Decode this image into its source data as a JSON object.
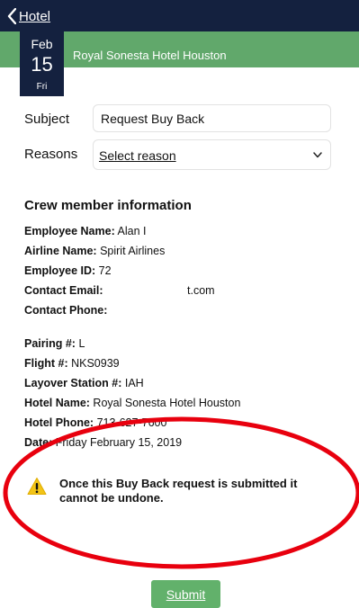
{
  "header": {
    "back_label": "Hotel",
    "hotel_name": "Royal Sonesta Hotel Houston",
    "date": {
      "month": "Feb",
      "day": "15",
      "weekday": "Fri"
    }
  },
  "form": {
    "subject_label": "Subject",
    "subject_value": "Request Buy Back",
    "reasons_label": "Reasons",
    "reasons_value": "Select reason"
  },
  "crew": {
    "title": "Crew member information",
    "rows": [
      {
        "label": "Employee Name:",
        "value": "Alan I"
      },
      {
        "label": "Airline Name:",
        "value": "Spirit Airlines"
      },
      {
        "label": "Employee ID:",
        "value": "72"
      },
      {
        "label": "Contact Email:",
        "value": "t.com"
      },
      {
        "label": "Contact Phone:",
        "value": ""
      }
    ],
    "trip_rows": [
      {
        "label": "Pairing #:",
        "value": "L"
      },
      {
        "label": "Flight #:",
        "value": "NKS0939"
      },
      {
        "label": "Layover Station #:",
        "value": "IAH"
      },
      {
        "label": "Hotel Name:",
        "value": "Royal Sonesta Hotel Houston"
      },
      {
        "label": "Hotel Phone:",
        "value": "713-627-7600"
      },
      {
        "label": "Date:",
        "value": "Friday February 15, 2019"
      }
    ]
  },
  "warning": {
    "text": "Once this Buy Back request is submitted it cannot be undone."
  },
  "submit_label": "Submit",
  "colors": {
    "navy": "#14213f",
    "green": "#61a86b",
    "annotation_red": "#e8000e"
  },
  "icons": {
    "back": "chevron-left-icon",
    "dropdown": "chevron-down-icon",
    "warning": "warning-triangle-icon"
  }
}
